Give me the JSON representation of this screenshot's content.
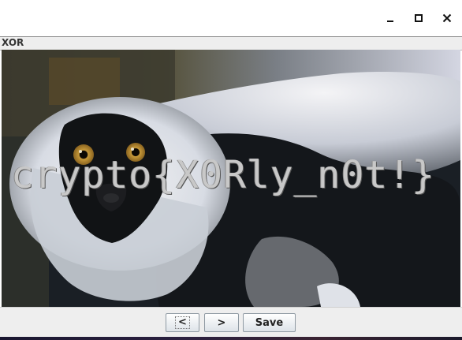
{
  "window": {
    "controls": {
      "minimize_icon": "minimize-icon",
      "maximize_icon": "maximize-icon",
      "close_icon": "close-icon"
    }
  },
  "panel": {
    "title": "XOR"
  },
  "image": {
    "subject": "lemur-photo",
    "overlay_text": "crypto{X0Rly_n0t!}"
  },
  "footer": {
    "prev_label": "<",
    "next_label": ">",
    "save_label": "Save"
  },
  "colors": {
    "titlebar_bg": "#ffffff",
    "panel_bg": "#eeeeee",
    "overlay_text": "#c8c8c8",
    "image_dark": "#151a1f"
  }
}
